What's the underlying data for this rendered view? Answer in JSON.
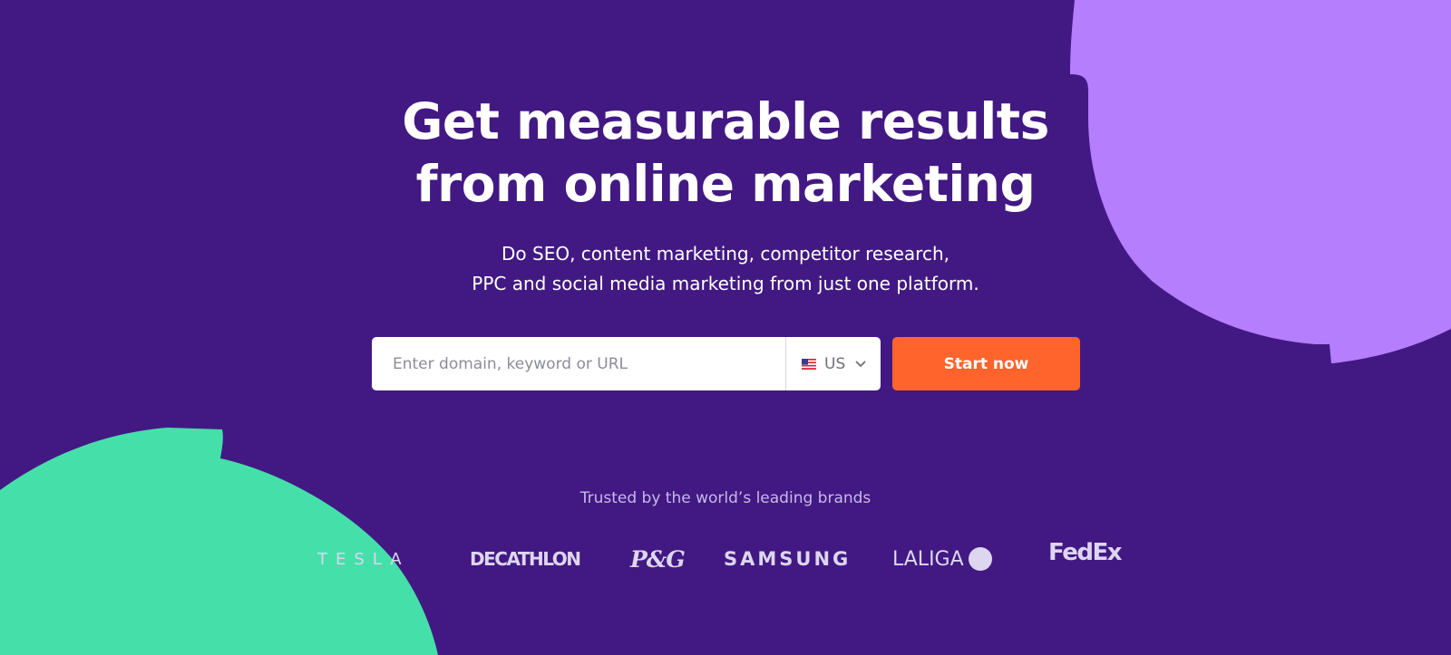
{
  "hero": {
    "headline_line1": "Get measurable results",
    "headline_line2": "from online marketing",
    "subheadline_line1": "Do SEO, content marketing, competitor research,",
    "subheadline_line2": "PPC and social media marketing from just one platform."
  },
  "search": {
    "placeholder": "Enter domain, keyword or URL",
    "value": "",
    "database_label": "US",
    "database_flag": "us-flag-icon"
  },
  "cta": {
    "label": "Start now"
  },
  "trusted": {
    "label": "Trusted by the world’s leading brands",
    "brands": [
      "TESLA",
      "DECATHLON",
      "P&G",
      "SAMSUNG",
      "LALIGA",
      "FedEx"
    ]
  },
  "colors": {
    "background": "#421983",
    "shape_purple": "#b57efc",
    "shape_green": "#45e0a9",
    "cta": "#ff642d",
    "logo": "#ddd6f0",
    "muted_text": "#c8b9e8"
  }
}
